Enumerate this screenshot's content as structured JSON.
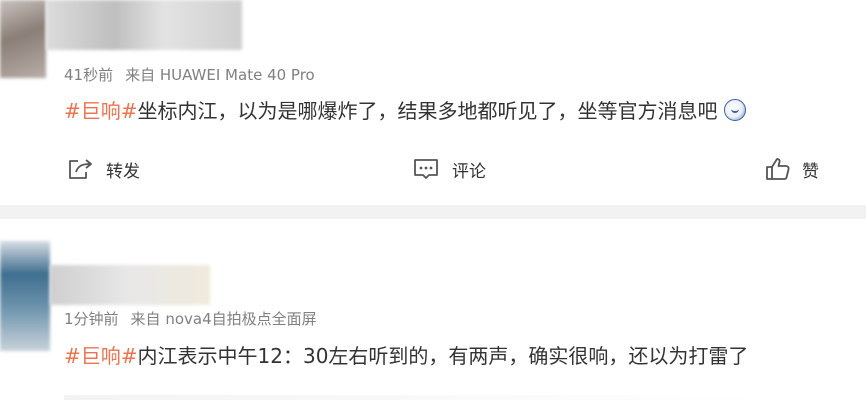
{
  "posts": [
    {
      "time": "41秒前",
      "source": "来自 HUAWEI Mate 40 Pro",
      "topic": "#巨响#",
      "text": "坐标内江，以为是哪爆炸了，结果多地都听见了，坐等官方消息吧",
      "emoji_icon": "face-emoji-icon",
      "actions": {
        "repost_label": "转发",
        "comment_label": "评论",
        "like_label": "赞"
      }
    },
    {
      "time": "1分钟前",
      "source": "来自 nova4自拍极点全面屏",
      "topic": "#巨响#",
      "text": "内江表示中午12：30左右听到的，有两声，确实很响，还以为打雷了"
    }
  ],
  "colors": {
    "topic": "#eb7350",
    "meta": "#808080",
    "text": "#333333",
    "separator": "#f2f2f2"
  }
}
